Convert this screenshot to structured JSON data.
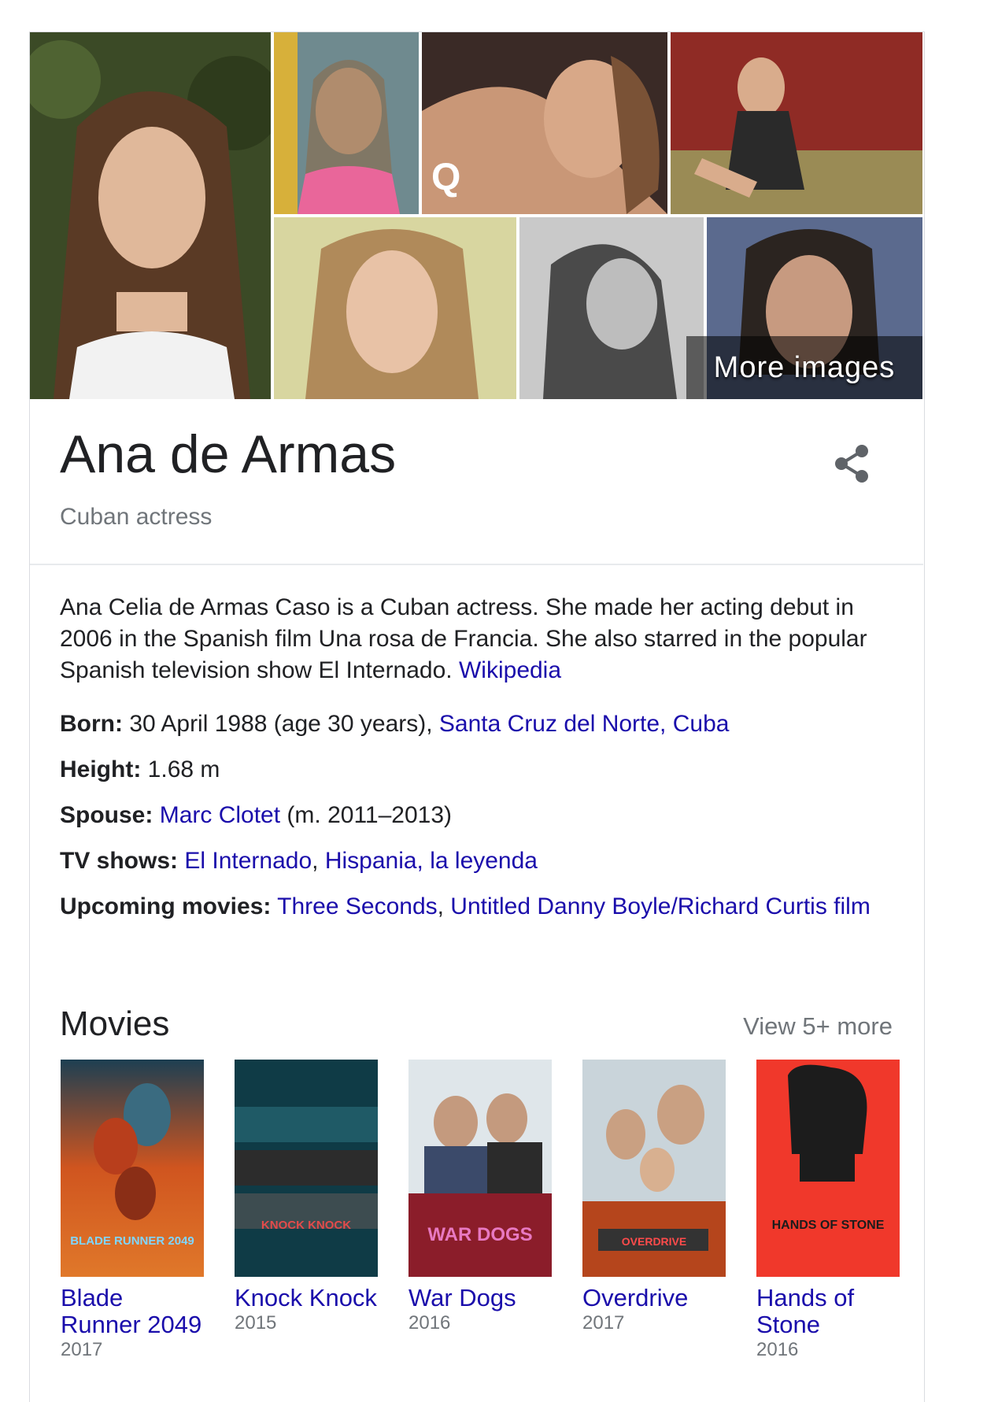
{
  "panel": {
    "name": "Ana de Armas",
    "subtitle": "Cuban actress",
    "more_images": "More images",
    "share_icon": "share-icon",
    "description": "Ana Celia de Armas Caso is a Cuban actress. She made her acting debut in 2006 in the Spanish film Una rosa de Francia. She also starred in the popular Spanish television show El Internado.",
    "source_link": "Wikipedia"
  },
  "facts": {
    "born_label": "Born:",
    "born_value": "30 April 1988 (age 30 years),",
    "born_place": "Santa Cruz del Norte, Cuba",
    "height_label": "Height:",
    "height_value": "1.68 m",
    "spouse_label": "Spouse:",
    "spouse_link": "Marc Clotet",
    "spouse_extra": "(m. 2011–2013)",
    "tv_label": "TV shows:",
    "tv_1": "El Internado",
    "tv_2": "Hispania, la leyenda",
    "upcoming_label": "Upcoming movies:",
    "upcoming_1": "Three Seconds",
    "upcoming_2": "Untitled Danny Boyle/Richard Curtis film"
  },
  "movies": {
    "heading": "Movies",
    "view_more": "View 5+ more",
    "items": [
      {
        "title": "Blade Runner 2049",
        "year": "2017",
        "poster_text": "BLADE RUNNER 2049"
      },
      {
        "title": "Knock Knock",
        "year": "2015",
        "poster_text": "KNOCK KNOCK"
      },
      {
        "title": "War Dogs",
        "year": "2016",
        "poster_text": "WAR DOGS"
      },
      {
        "title": "Overdrive",
        "year": "2017",
        "poster_text": "OVERDRIVE"
      },
      {
        "title": "Hands of Stone",
        "year": "2016",
        "poster_text": "HANDS OF STONE"
      }
    ]
  },
  "colors": {
    "link": "#1a0dab",
    "muted": "#70757a",
    "text": "#202124"
  }
}
